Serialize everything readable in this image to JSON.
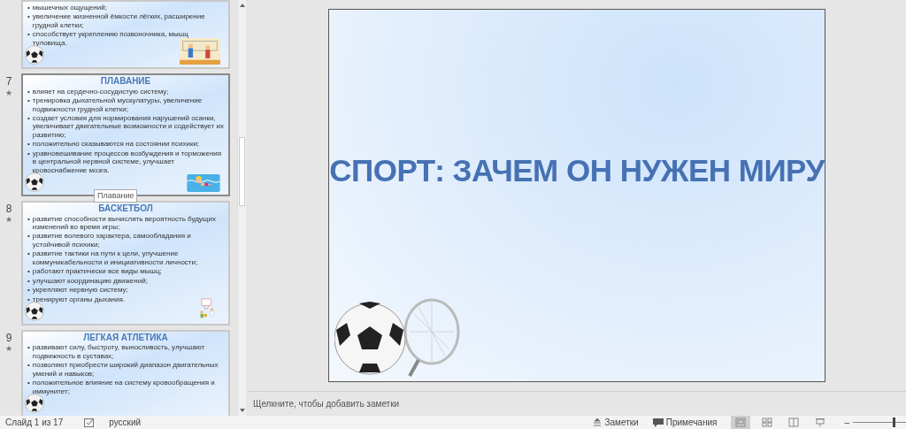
{
  "thumbnails": [
    {
      "kind": "volleyball",
      "bullets": [
        "мышечных ощущений;",
        "увеличение жизненной ёмкости лёгких, расширение грудной клетки;",
        "способствует укреплению позвоночника, мышц туловища."
      ]
    },
    {
      "number": "7",
      "animation_mark": "★",
      "hovered": true,
      "title": "ПЛАВАНИЕ",
      "kind": "swimmer",
      "bullets": [
        "влияет на сердечно-сосудистую систему;",
        "тренировка дыхательной мускулатуры, увеличение подвижности грудной клетки;",
        "создает условия для нормирования нарушений осанки, увеличивает двигательные возможности и содействует их развитию;",
        "положительно сказываются на состоянии психики;",
        "уравновешивание процессов возбуждения и торможения в центральной нервной системе, улучшает кровоснабжение мозга."
      ]
    },
    {
      "number": "8",
      "animation_mark": "★",
      "hovered": false,
      "title": "БАСКЕТБОЛ",
      "kind": "basketball",
      "bullets": [
        "развитие способности вычислять вероятность будущих изменений во время игры;",
        "развитие волевого характера, самообладания и устойчивой психики;",
        "развитие тактики на пути к цели, улучшение коммуникабельности и инициативности личности;",
        "работают практически все виды мышц;",
        "улучшают координацию движений;",
        "укрепляют нервную систему;",
        "тренируют органы дыхания."
      ]
    },
    {
      "number": "9",
      "animation_mark": "★",
      "hovered": false,
      "title": "ЛЕГКАЯ АТЛЕТИКА",
      "kind": "plain",
      "bullets": [
        "развивают силу, быстроту, выносливость, улучшают подвижность в суставах;",
        "позволяют приобрести широкий диапазон двигательных умений и навыков;",
        "положительное влияние на систему кровообращения и иммунитет;"
      ]
    }
  ],
  "bullet_marker": "•",
  "tooltip": "Плавание",
  "slide": {
    "title": "СПОРТ: ЗАЧЕМ ОН НУЖЕН МИРУ"
  },
  "notes": {
    "placeholder": "Щелкните, чтобы добавить заметки"
  },
  "status_bar": {
    "slide_counter": "Слайд 1 из 17",
    "language": "русский",
    "notes_button": "Заметки",
    "comments_button": "Примечания",
    "views": [
      {
        "kind": "normal",
        "selected": true
      },
      {
        "kind": "sorter",
        "selected": false
      },
      {
        "kind": "reading",
        "selected": false
      },
      {
        "kind": "slideshow",
        "selected": false
      }
    ],
    "zoom_out": "–",
    "zoom": {
      "level": 0.8
    }
  }
}
